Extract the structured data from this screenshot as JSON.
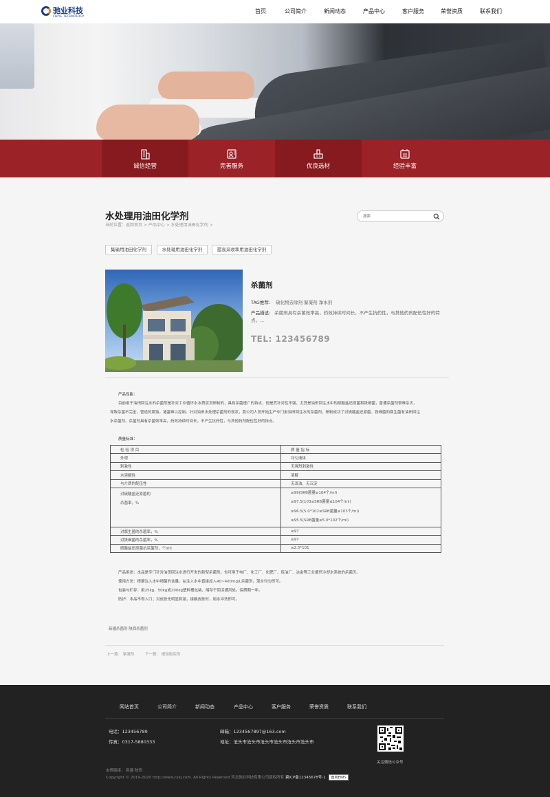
{
  "header": {
    "logo_text": "驰业科技",
    "logo_en": "CHIYE TECHNOLOGY",
    "nav": [
      "首页",
      "公司简介",
      "新闻动态",
      "产品中心",
      "客户服务",
      "荣誉资质",
      "联系我们"
    ]
  },
  "features": [
    {
      "label": "诚信经营",
      "icon": "building-icon"
    },
    {
      "label": "完善服务",
      "icon": "service-person-icon"
    },
    {
      "label": "优良选材",
      "icon": "factory-icon"
    },
    {
      "label": "经验丰富",
      "icon": "calendar-list-icon"
    }
  ],
  "page": {
    "title": "水处理用油田化学剂",
    "breadcrumb": "当前位置：返回首页 > 产品中心 > 水处理用油田化学剂 >",
    "search_placeholder": "搜索"
  },
  "category_tags": [
    "集输用油田化学剂",
    "水处理用油田化学剂",
    "提高采收率用油田化学剂"
  ],
  "product": {
    "name": "杀菌剂",
    "tag_label": "TAG推荐:",
    "tags": "硫化物去除剂  絮凝剂  净水剂",
    "desc_label": "产品描述:",
    "desc": "杀菌剂具有杀菌效率高，药效持续时间长，不产生抗药性，与其他药剂配伍性好的特点。...",
    "tel": "TEL: 123456789"
  },
  "detail": {
    "perf_title": "产品性能：",
    "perf_lines": [
      "目前用于油田回注水的杀菌剂是针对工业循环水水质状况研制的，具有杀菌速广的特点，但是其针对性不强，尤其是油田回注水中的硫酸盐还原菌和铁细菌，普通杀菌剂很难杀灭，",
      "导致杀菌不完全，管道的腐蚀，堵塞难以控制。针对油田水处理杀菌剂的现状，我公司人员开始生产专门用油田回注水的杀菌剂，研制成功了对硫酸盐还原菌、铁细菌和腐生菌有油田回注",
      "水杀菌剂。杀菌剂具有杀菌效率高，药效持续时间长，不产生抗药性，与其他药剂配伍性好的特点。"
    ],
    "quality_title": "质量标准：",
    "table_header": [
      "检 验 项 目",
      "质 量 指 标"
    ],
    "table_rows": [
      {
        "item": "外观",
        "value": "均匀液体"
      },
      {
        "item": "刺激性",
        "value": "无强烈刺激性"
      },
      {
        "item": "水溶解性",
        "value": "溶解"
      },
      {
        "item": "与介质的配伍性",
        "value": "无浑浊、无沉淀"
      }
    ],
    "srb_item_1": "对硫酸盐还原菌的",
    "srb_item_2": "杀菌率，%",
    "srb_values": [
      "≥99(SRB菌量≥104个/ml)",
      "≥97.5(103≤SRB菌量≤104个/ml)",
      "≥96.5(5.0*102≤SRB菌量≤103个/ml)",
      "≥95.5(SRB菌量≤5.0*102个/ml)"
    ],
    "table_rows_2": [
      {
        "item": "对腐生菌的杀菌率，%",
        "value": "≥97"
      },
      {
        "item": "对铁细菌的杀菌率，%",
        "value": "≥97"
      },
      {
        "item": "硫酸盐还原菌抗杀菌剂，个/ml",
        "value": "≤2.5*101"
      }
    ],
    "usage_lines": [
      "产品用途：本品是专门针对油田回注水进行开发的新型杀菌剂，也可用于电厂、化工厂、化肥厂、炼油厂、冶金等工业循环冷却水系统的杀菌灭。",
      "使用方法：根据注入水中细菌的含量，在注入水中直接加入40~400mg/L杀菌剂，混合均匀即可。",
      "包装与贮存：用25kg、50kg或200kg塑料桶包装，储存于阴凉通风处。保质期一年。",
      "防护：本品不得入口；对皮肤无明显刺激，接触皮肤时，用水冲洗即可。"
    ],
    "related": "新疆杀菌剂   陕西杀菌剂",
    "prev": "上一篇：  絮凝剂",
    "next": "下一篇：  缓蚀阻垢剂"
  },
  "footer": {
    "nav": [
      "网站首页",
      "公司简介",
      "新闻动态",
      "产品中心",
      "客户服务",
      "荣誉资质",
      "联系我们"
    ],
    "phone": "电话：123456789",
    "fax": "传真：0317-5880333",
    "email": "邮箱：1234567897@163.com",
    "address": "地址：沧头市沧头市沧头市沧头市沧头市沧头市",
    "qr_label": "关注微信公众号",
    "links": "友情链接：   新疆    陕西",
    "copyright": "Copyright © 2019-2020 http://www.cykj.com. All Rights Reserved 河北驰业科技有限公司版权所有",
    "icp": "冀ICP备12345678号-1",
    "badge": "盘商EIMS"
  },
  "colors": {
    "brand_red": "#9b2227",
    "brand_red_dark": "#861a1f",
    "logo_blue": "#1b3d8f",
    "footer_bg": "#222222"
  }
}
